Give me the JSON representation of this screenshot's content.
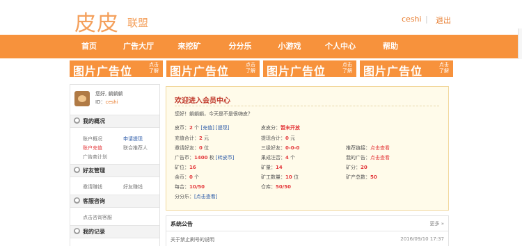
{
  "header": {
    "logo_main": "皮皮",
    "logo_sub": "联盟",
    "user": "ceshi",
    "separator": "|",
    "logout": "退出"
  },
  "nav": [
    "首页",
    "广告大厅",
    "来挖矿",
    "分分乐",
    "小游戏",
    "个人中心",
    "帮助"
  ],
  "ads": [
    {
      "text": "图片广告位",
      "click": "点击了解"
    },
    {
      "text": "图片广告位",
      "click": "点击了解"
    },
    {
      "text": "图片广告位",
      "click": "点击了解"
    },
    {
      "text": "图片广告位",
      "click": "点击了解"
    }
  ],
  "sidebar": {
    "greeting": "您好, 躺躺躺",
    "id_label": "ID：",
    "id_value": "ceshi",
    "sections": [
      {
        "title": "我的概况",
        "icon": "user-icon"
      },
      {
        "title": "好友管理",
        "icon": "friends-icon"
      },
      {
        "title": "客服咨询",
        "icon": "support-icon"
      },
      {
        "title": "我的记录",
        "icon": "record-icon"
      }
    ],
    "links": {
      "overview": "账户概况",
      "apply": "申请提现",
      "recharge": "账户充值",
      "promote": "联合推荐人",
      "ad_plan": "广告商计划",
      "invite": "邀请赚钱",
      "friend_profit": "好友赚钱",
      "consult": "点击咨询客服"
    }
  },
  "main": {
    "title": "欢迎进入会员中心",
    "welcome": "您好！躺躺躺，今天是不是很嗨皮？",
    "rows": [
      [
        {
          "label": "皮币：",
          "value": "2",
          "suffix": "个",
          "links": [
            "[充值]",
            "[提现]"
          ]
        },
        {
          "label": "皮皮分：",
          "value": "暂未开放"
        }
      ],
      [
        {
          "label": "充值合计：",
          "value": "2",
          "suffix": "元"
        },
        {
          "label": "提现合计：",
          "value": "0",
          "suffix": "元"
        }
      ],
      [
        {
          "label": "邀请好友：",
          "value": "0",
          "suffix": "位"
        },
        {
          "label": "三级好友：",
          "value": "0-0-0"
        },
        {
          "label": "推荐链接：",
          "red_link": "点击查看"
        }
      ],
      [
        {
          "label": "广告币：",
          "value": "1400",
          "suffix": "枚",
          "links": [
            "[转皮币]"
          ]
        },
        {
          "label": "果成注否：",
          "value": "4",
          "suffix": "个"
        },
        {
          "label": "我的广告：",
          "red_link": "点击查看"
        }
      ],
      [
        {
          "label": "矿位：",
          "value": "16"
        },
        {
          "label": "矿量：",
          "value": "14"
        },
        {
          "label": "矿分：",
          "value": "20"
        }
      ],
      [
        {
          "label": "余币：",
          "value": "0",
          "suffix": "个"
        },
        {
          "label": "矿工数量：",
          "value": "10",
          "suffix": "位"
        },
        {
          "label": "矿产总数：",
          "value": "50"
        }
      ],
      [
        {
          "label": "每合：",
          "value": "10/50"
        },
        {
          "label": "仓库：",
          "value": "50/50"
        }
      ],
      [
        {
          "label": "分分乐：",
          "links": [
            "[点击查看]"
          ]
        }
      ]
    ]
  },
  "notice": {
    "title": "系统公告",
    "more": "更多 »",
    "item": "关于禁止刷号的说明",
    "date": "2016/09/10 17:37"
  }
}
